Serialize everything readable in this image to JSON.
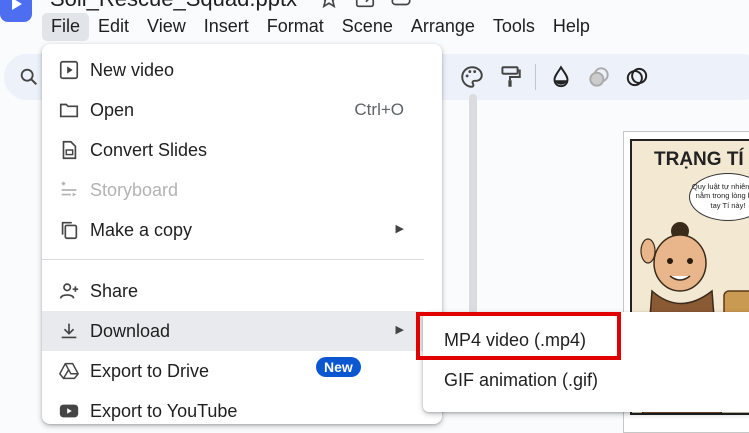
{
  "app": {
    "title": "Soil_Rescue_Squad.pptx",
    "logo_icon": "play-icon",
    "accent_color": "#4e6ef2"
  },
  "menubar": {
    "items": [
      "File",
      "Edit",
      "View",
      "Insert",
      "Format",
      "Scene",
      "Arrange",
      "Tools",
      "Help"
    ],
    "active": "File"
  },
  "toolbar": {
    "icons": [
      "search-icon",
      "palette-icon",
      "paint-format-icon",
      "fill-color-icon",
      "effects-icon",
      "opacity-icon"
    ]
  },
  "file_menu": {
    "items": [
      {
        "label": "New video",
        "icon": "new-video-icon"
      },
      {
        "label": "Open",
        "icon": "folder-icon",
        "shortcut": "Ctrl+O"
      },
      {
        "label": "Convert Slides",
        "icon": "convert-slides-icon"
      },
      {
        "label": "Storyboard",
        "icon": "storyboard-icon",
        "disabled": true
      },
      {
        "label": "Make a copy",
        "icon": "copy-icon",
        "submenu": true
      },
      {
        "label": "Share",
        "icon": "share-icon"
      },
      {
        "label": "Download",
        "icon": "download-icon",
        "submenu": true,
        "hovered": true
      },
      {
        "label": "Export to Drive",
        "icon": "drive-icon"
      },
      {
        "label": "Export to YouTube",
        "icon": "youtube-icon",
        "badge": "New"
      }
    ]
  },
  "download_submenu": {
    "items": [
      {
        "label": "MP4 video (.mp4)",
        "highlighted": true
      },
      {
        "label": "GIF animation (.gif)"
      }
    ],
    "highlight_color": "#e00000"
  },
  "slide_preview": {
    "title": "TRẠNG TÍ",
    "bubble_text": "Quy luật tự nhiên đều nằm trong lòng bàn tay Tí này!"
  }
}
